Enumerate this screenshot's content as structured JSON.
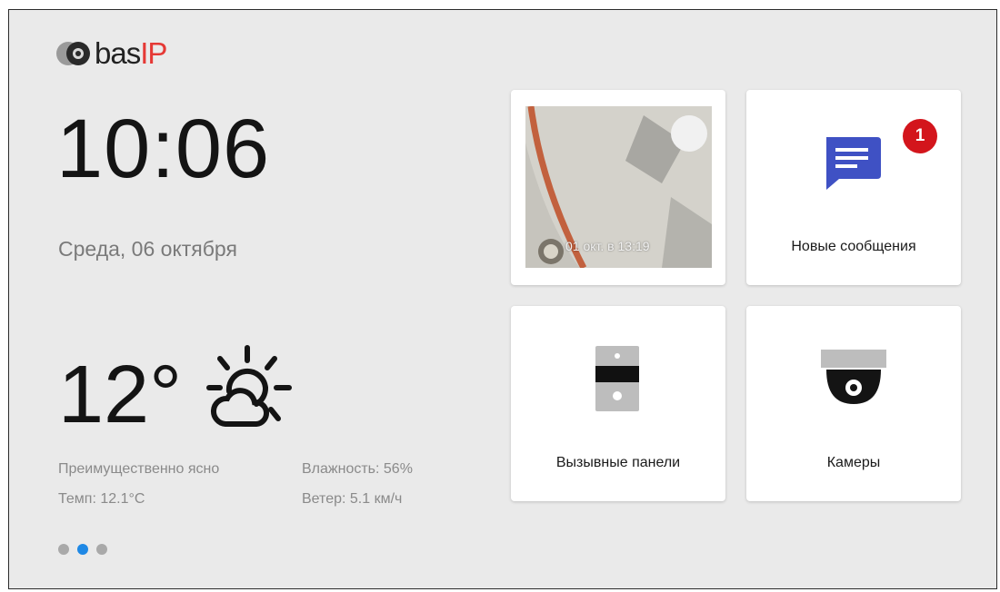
{
  "logo": {
    "text": "bas",
    "accent": "IP"
  },
  "clock": {
    "time": "10:06",
    "date": "Среда, 06 октября"
  },
  "weather": {
    "temperature": "12°",
    "icon": "partly-cloudy-icon",
    "condition": "Преимущественно ясно",
    "temp_detail": "Темп: 12.1°С",
    "humidity": "Влажность: 56%",
    "wind": "Ветер: 5.1 км/ч"
  },
  "pager": {
    "count": 3,
    "active_index": 1
  },
  "tiles": {
    "snapshot": {
      "timestamp": "01 окт. в 13:19"
    },
    "messages": {
      "label": "Новые сообщения",
      "badge": "1",
      "icon": "message-icon"
    },
    "panels": {
      "label": "Вызывные панели",
      "icon": "door-panel-icon"
    },
    "cameras": {
      "label": "Камеры",
      "icon": "dome-camera-icon"
    }
  },
  "colors": {
    "accent": "#1e88e5",
    "badge": "#d3151c",
    "brand": "#e53935",
    "message_icon": "#3f51c4"
  }
}
